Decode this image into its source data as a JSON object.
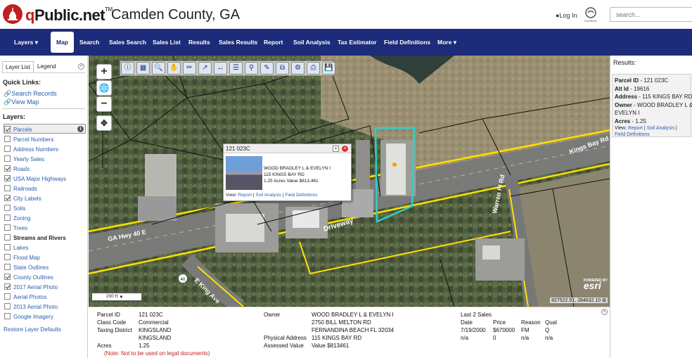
{
  "header": {
    "brand": "qPublic.net",
    "brand_tm": "TM",
    "county": "Camden County, GA",
    "login": "Log In",
    "search_placeholder": "search..."
  },
  "nav": {
    "items": [
      "Layers",
      "Map",
      "Search",
      "Sales Search",
      "Sales List",
      "Results",
      "Sales Results",
      "Report",
      "Soil Analysis",
      "Tax Estimator",
      "Field Definitions",
      "More"
    ],
    "active": "Map"
  },
  "left": {
    "tabs": [
      "Layer List",
      "Legend"
    ],
    "quick_links_title": "Quick Links:",
    "quick_links": [
      "Search Records",
      "View Map"
    ],
    "layers_title": "Layers:",
    "layers": [
      {
        "label": "Parcels",
        "checked": true
      },
      {
        "label": "Parcel Numbers",
        "checked": false
      },
      {
        "label": "Address Numbers",
        "checked": false
      },
      {
        "label": "Yearly Sales",
        "checked": false
      },
      {
        "label": "Roads",
        "checked": true
      },
      {
        "label": "USA Major Highways",
        "checked": true
      },
      {
        "label": "Railroads",
        "checked": false
      },
      {
        "label": "City Labels",
        "checked": true
      },
      {
        "label": "Soils",
        "checked": false
      },
      {
        "label": "Zoning",
        "checked": false
      },
      {
        "label": "Trees",
        "checked": false
      },
      {
        "label": "Streams and Rivers",
        "checked": false
      },
      {
        "label": "Lakes",
        "checked": false
      },
      {
        "label": "Flood Map",
        "checked": false
      },
      {
        "label": "State Outlines",
        "checked": false
      },
      {
        "label": "County Outlines",
        "checked": true
      },
      {
        "label": "2017 Aerial Photo",
        "checked": true
      },
      {
        "label": "Aerial Photos",
        "checked": false
      },
      {
        "label": "2013 Aerial Photo",
        "checked": false
      },
      {
        "label": "Google Imagery",
        "checked": false
      }
    ],
    "restore": "Restore Layer Defaults"
  },
  "map": {
    "road_labels": [
      "GA Hwy 40 E",
      "E King Ave",
      "Driveway",
      "Kings Bay Rd",
      "Warren Pl Rd",
      "40"
    ],
    "scale_label": "200 ft",
    "coords": "827522.51, 284632.10",
    "esri_powered": "POWERED BY",
    "esri": "esri",
    "popup": {
      "title": "121 023C",
      "owner": "WOOD BRADLEY L & EVELYN I",
      "address": "115 KINGS BAY RD",
      "acres_value": "1.25 Acres  Value $813,461",
      "view": "View:",
      "links": [
        "Report",
        "Soil Analysis",
        "Field Definitions"
      ]
    }
  },
  "results": {
    "title": "Results:",
    "parcel_id_label": "Parcel ID",
    "parcel_id": "121 023C",
    "alt_id_label": "Alt Id",
    "alt_id": "19616",
    "address_label": "Address",
    "address": "115 KINGS BAY RD",
    "owner_label": "Owner",
    "owner_line1": "WOOD BRADLEY L &",
    "owner_line2": "EVELYN I",
    "acres_label": "Acres",
    "acres": "1.25",
    "view": "View:",
    "links": [
      "Report",
      "Soil Analysis",
      "Field Definitions"
    ]
  },
  "details": {
    "parcel_id_label": "Parcel ID",
    "parcel_id": "121 023C",
    "class_code_label": "Class Code",
    "class_code": "Commercial",
    "taxing_district_label": "Taxing District",
    "taxing_district1": "KINGSLAND",
    "taxing_district2": "KINGSLAND",
    "acres_label": "Acres",
    "acres": "1.25",
    "note": "(Note: Not to be used on legal documents)",
    "owner_label": "Owner",
    "owner1": "WOOD BRADLEY L & EVELYN I",
    "owner2": "2750 BILL MELTON RD",
    "owner3": "FERNANDINA BEACH FL 32034",
    "physical_address_label": "Physical Address",
    "physical_address": "115 KINGS BAY RD",
    "assessed_value_label": "Assessed Value",
    "assessed_value": "Value $813461",
    "sales_title": "Last 2 Sales",
    "sales_headers": [
      "Date",
      "Price",
      "Reason",
      "Qual"
    ],
    "sales_rows": [
      [
        "7/19/2000",
        "$670000",
        "FM",
        "Q"
      ],
      [
        "n/a",
        "0",
        "n/a",
        "n/a"
      ]
    ]
  },
  "colors": {
    "nav_bg": "#1c2b7a",
    "parcel_outline": "#2ed1c8",
    "road_highlight": "#ffe000",
    "link": "#2a5db0"
  }
}
